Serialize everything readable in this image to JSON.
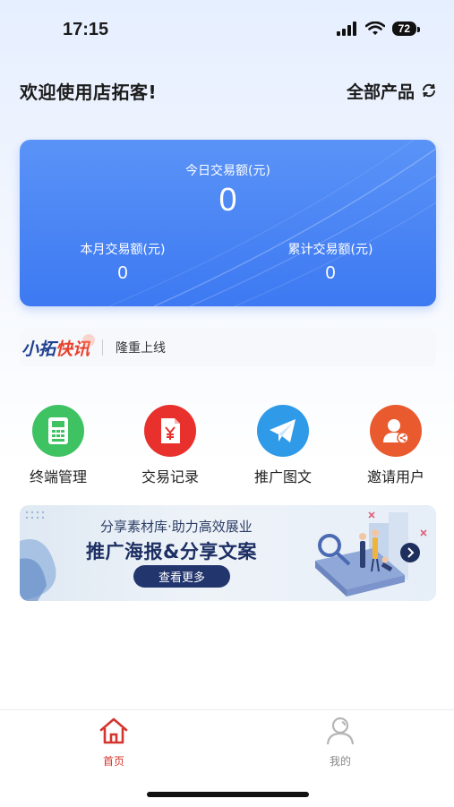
{
  "status_bar": {
    "time": "17:15",
    "battery": "72"
  },
  "header": {
    "welcome": "欢迎使用店拓客!",
    "product_switch": "全部产品"
  },
  "stats": {
    "today_label": "今日交易额(元)",
    "today_value": "0",
    "month_label": "本月交易额(元)",
    "month_value": "0",
    "total_label": "累计交易额(元)",
    "total_value": "0"
  },
  "news": {
    "logo_part1": "小拓",
    "logo_part2": "快讯",
    "text": "隆重上线"
  },
  "quick_actions": [
    {
      "label": "终端管理",
      "icon": "terminal-icon",
      "color": "#3fc262"
    },
    {
      "label": "交易记录",
      "icon": "receipt-yuan-icon",
      "color": "#e8312c"
    },
    {
      "label": "推广图文",
      "icon": "paper-plane-icon",
      "color": "#2f9ae8"
    },
    {
      "label": "邀请用户",
      "icon": "invite-user-icon",
      "color": "#ea5a2f"
    }
  ],
  "banner": {
    "subtitle": "分享素材库·助力高效展业",
    "title": "推广海报&分享文案",
    "button": "查看更多"
  },
  "tab_bar": {
    "items": [
      {
        "label": "首页",
        "icon": "home-icon",
        "active": true
      },
      {
        "label": "我的",
        "icon": "user-icon",
        "active": false
      }
    ]
  },
  "colors": {
    "accent": "#3d79f2",
    "active_tab": "#d3362e"
  }
}
